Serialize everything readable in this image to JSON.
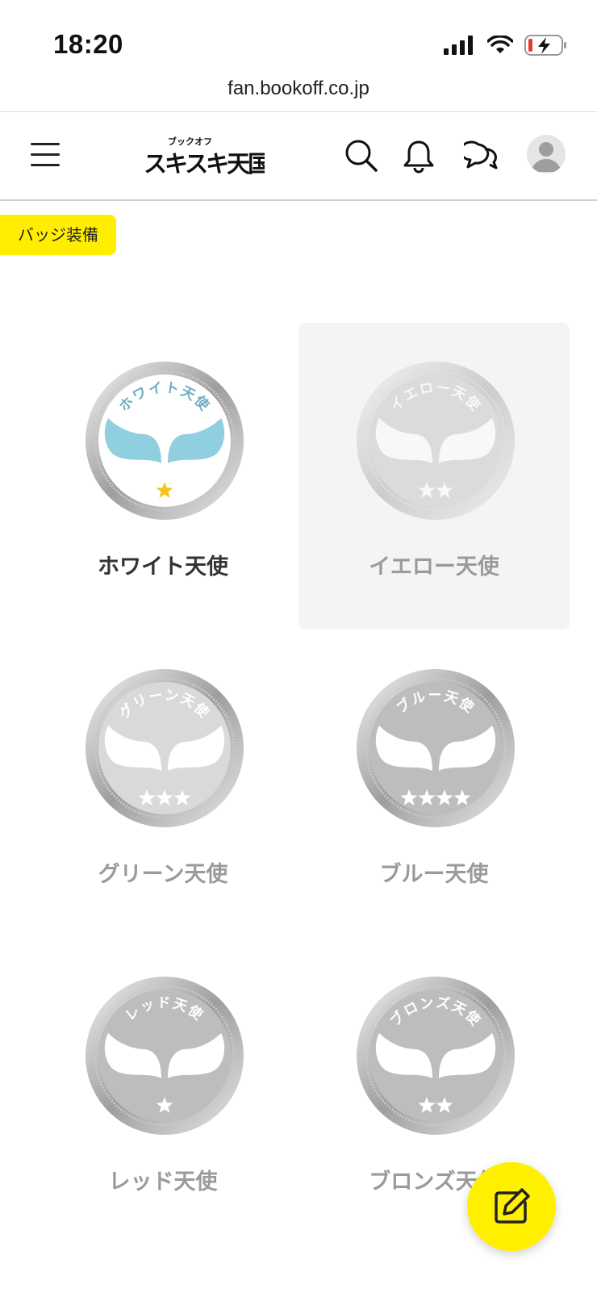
{
  "status_bar": {
    "time": "18:20"
  },
  "browser": {
    "url": "fan.bookoff.co.jp"
  },
  "header": {
    "logo_small": "ブックオフ",
    "logo_main": "スキスキ天国"
  },
  "equip_tag": "バッジ装備",
  "badges": [
    {
      "name": "ホワイト天使",
      "arc_text": "ホワイト天使",
      "stars": 1,
      "state": "owned",
      "selected": false
    },
    {
      "name": "イエロー天使",
      "arc_text": "イエロー天使",
      "stars": 2,
      "state": "locked",
      "selected": true
    },
    {
      "name": "グリーン天使",
      "arc_text": "グリーン天使",
      "stars": 3,
      "state": "locked",
      "selected": false
    },
    {
      "name": "ブルー天使",
      "arc_text": "ブルー天使",
      "stars": 4,
      "state": "locked",
      "selected": false
    },
    {
      "name": "レッド天使",
      "arc_text": "レッド天使",
      "stars": 1,
      "state": "locked",
      "selected": false
    },
    {
      "name": "ブロンズ天使",
      "arc_text": "ブロンズ天使",
      "stars": 2,
      "state": "locked",
      "selected": false
    }
  ],
  "colors": {
    "accent_yellow": "#ffee00",
    "wing_blue": "#8fcfe0",
    "star_gold": "#f5c518",
    "locked_text": "#9a9a9a"
  }
}
